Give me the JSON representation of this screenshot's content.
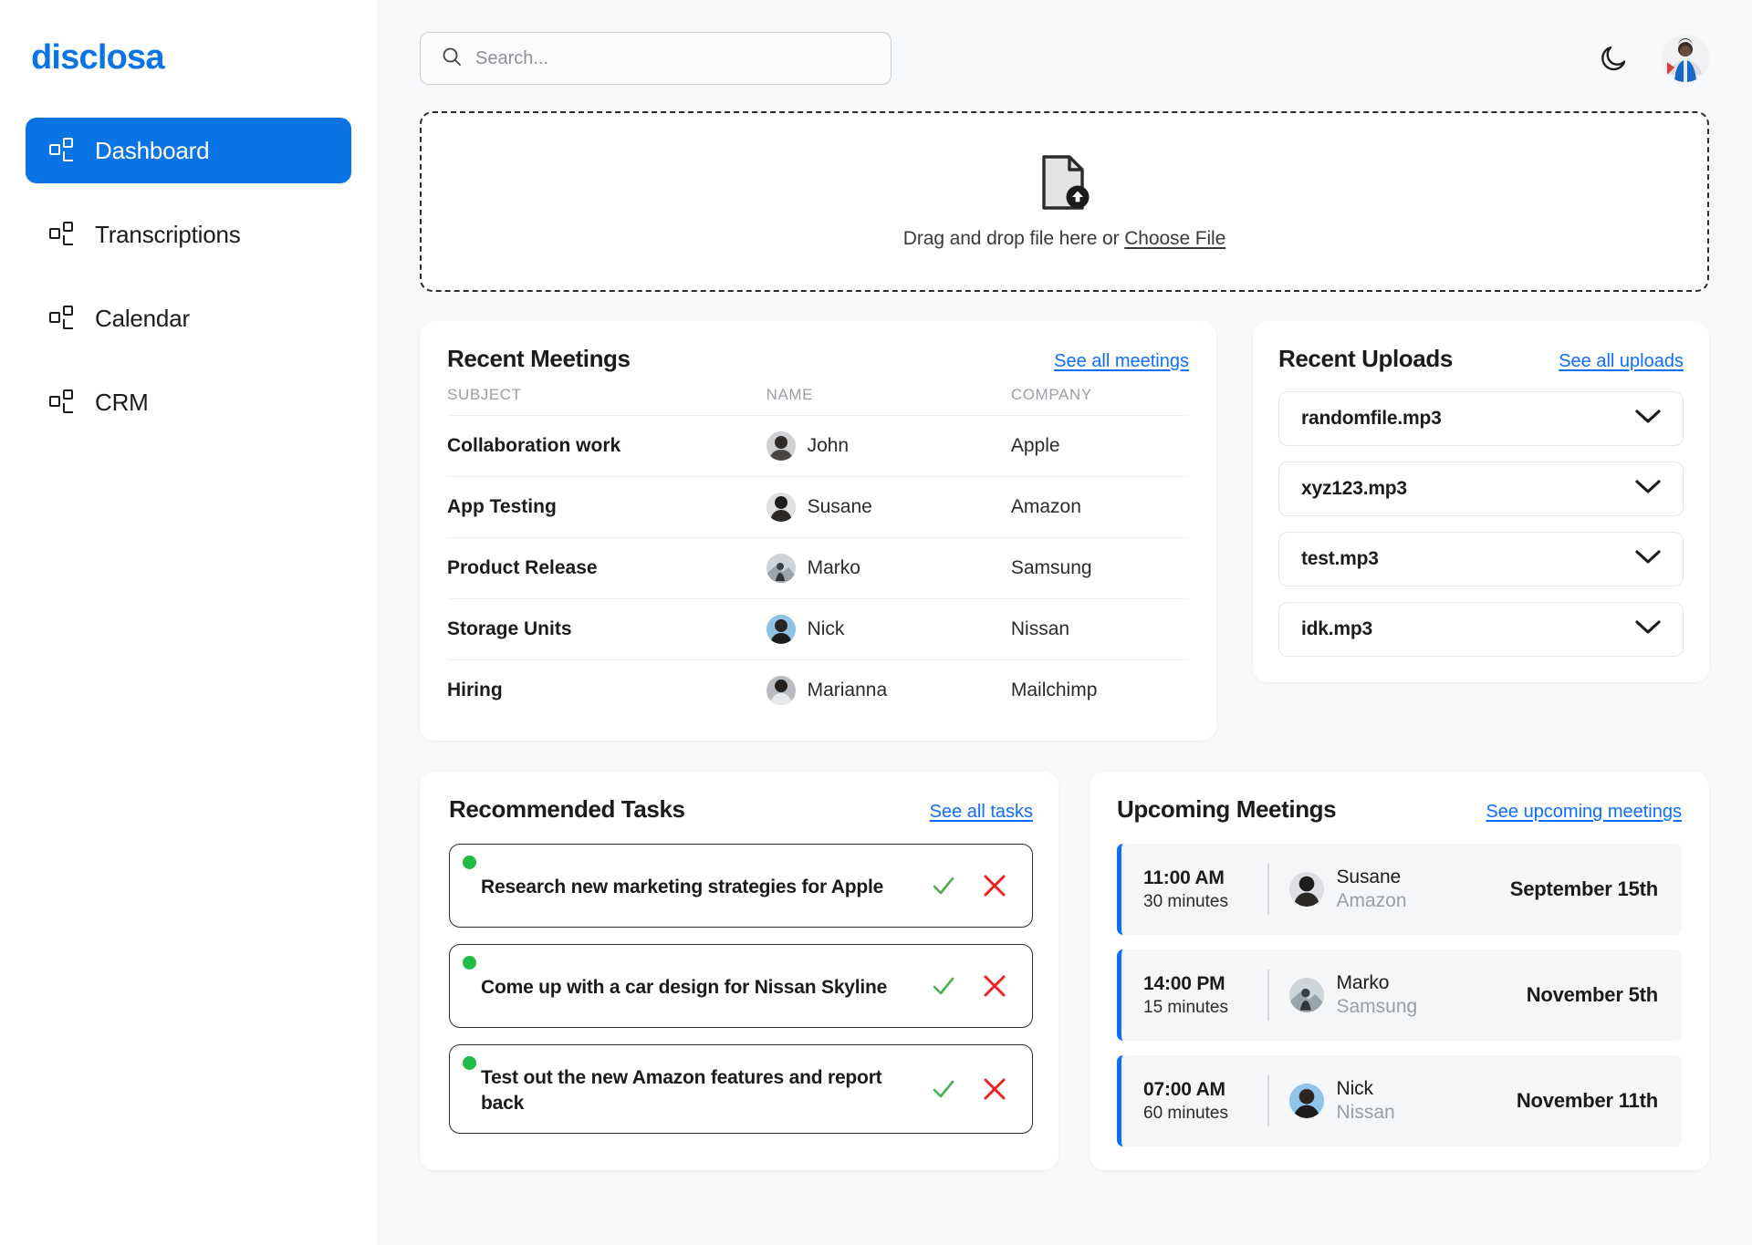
{
  "brand": {
    "name": "disclosa",
    "color": "#0b74e5"
  },
  "sidebar": {
    "items": [
      {
        "label": "Dashboard",
        "icon": "grid-icon",
        "active": true
      },
      {
        "label": "Transcriptions",
        "icon": "grid-icon",
        "active": false
      },
      {
        "label": "Calendar",
        "icon": "grid-icon",
        "active": false
      },
      {
        "label": "CRM",
        "icon": "grid-icon",
        "active": false
      }
    ]
  },
  "topbar": {
    "search_placeholder": "Search...",
    "search_value": "",
    "search_icon": "search-icon",
    "theme_toggle_icon": "moon-icon",
    "avatar_icon": "user-avatar"
  },
  "dropzone": {
    "icon": "file-upload-icon",
    "text": "Drag and drop file here or ",
    "link": "Choose File"
  },
  "recent_meetings": {
    "title": "Recent Meetings",
    "link": "See all meetings",
    "columns": [
      "SUBJECT",
      "NAME",
      "COMPANY"
    ],
    "rows": [
      {
        "subject": "Collaboration work",
        "name": "John",
        "company": "Apple"
      },
      {
        "subject": "App Testing",
        "name": "Susane",
        "company": "Amazon"
      },
      {
        "subject": "Product Release",
        "name": "Marko",
        "company": "Samsung"
      },
      {
        "subject": "Storage Units",
        "name": "Nick",
        "company": "Nissan"
      },
      {
        "subject": "Hiring",
        "name": "Marianna",
        "company": "Mailchimp"
      }
    ]
  },
  "recent_uploads": {
    "title": "Recent Uploads",
    "link": "See all uploads",
    "items": [
      {
        "name": "randomfile.mp3",
        "chevron": "chevron-down-icon"
      },
      {
        "name": "xyz123.mp3",
        "chevron": "chevron-down-icon"
      },
      {
        "name": "test.mp3",
        "chevron": "chevron-down-icon"
      },
      {
        "name": "idk.mp3",
        "chevron": "chevron-down-icon"
      }
    ]
  },
  "recommended_tasks": {
    "title": "Recommended Tasks",
    "link": "See all tasks",
    "accept_icon": "check-icon",
    "reject_icon": "close-icon",
    "status_color": "#22bb44",
    "accept_color": "#4caf50",
    "reject_color": "#f02020",
    "items": [
      {
        "text": "Research new marketing strategies for Apple"
      },
      {
        "text": "Come up with a car design for Nissan Skyline"
      },
      {
        "text": "Test out the new Amazon features and report back"
      }
    ]
  },
  "upcoming_meetings": {
    "title": "Upcoming Meetings",
    "link": "See upcoming meetings",
    "accent_color": "#0d6efd",
    "items": [
      {
        "time": "11:00 AM",
        "duration": "30 minutes",
        "name": "Susane",
        "company": "Amazon",
        "date": "September 15th"
      },
      {
        "time": "14:00 PM",
        "duration": "15 minutes",
        "name": "Marko",
        "company": "Samsung",
        "date": "November 5th"
      },
      {
        "time": "07:00 AM",
        "duration": "60 minutes",
        "name": "Nick",
        "company": "Nissan",
        "date": "November 11th"
      }
    ]
  }
}
